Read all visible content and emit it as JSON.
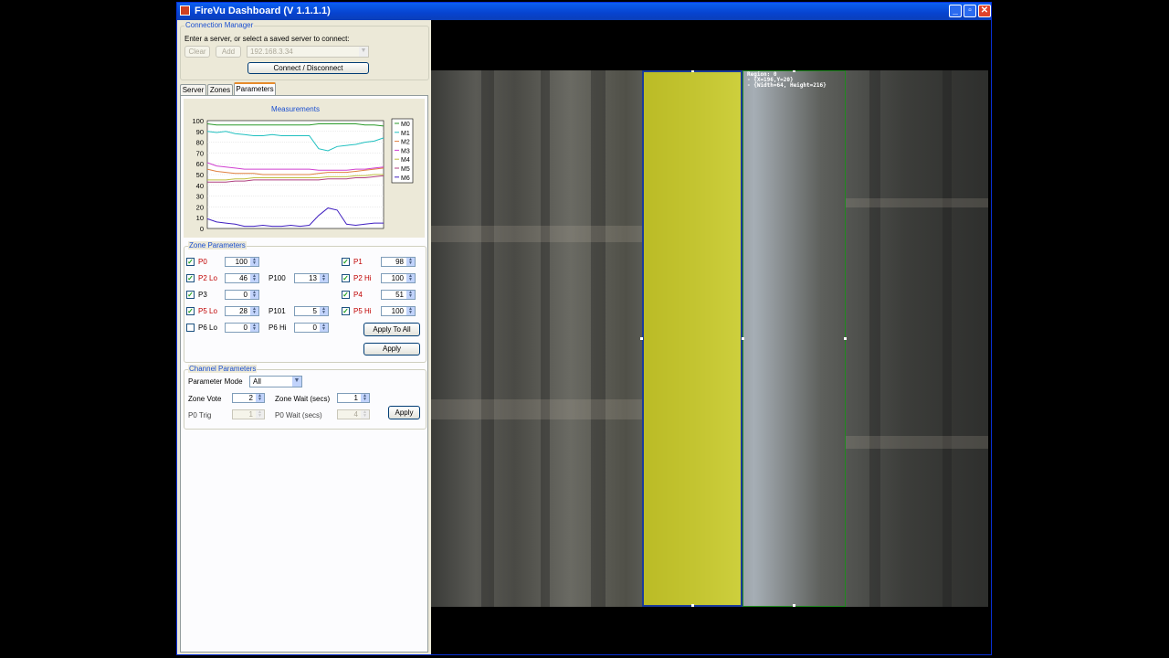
{
  "window": {
    "title": "FireVu Dashboard (V 1.1.1.1)"
  },
  "connection": {
    "legend": "Connection Manager",
    "prompt": "Enter a server, or select a saved server to connect:",
    "clear_label": "Clear",
    "add_label": "Add",
    "server_value": "192.168.3.34",
    "connect_label": "Connect / Disconnect"
  },
  "tabs": [
    "Server",
    "Zones",
    "Parameters"
  ],
  "chart_data": {
    "type": "line",
    "title": "Measurements",
    "xlabel": "",
    "ylabel": "",
    "ylim": [
      0,
      100
    ],
    "yticks": [
      "100",
      "90",
      "80",
      "70",
      "60",
      "50",
      "40",
      "30",
      "20",
      "10",
      "0"
    ],
    "legend_placement": "right",
    "series": [
      {
        "name": "M0",
        "color": "#2a9a2a",
        "values": [
          97,
          96,
          96,
          96,
          96,
          96,
          96,
          96,
          96,
          96,
          96,
          96,
          97,
          97,
          97,
          97,
          97,
          96,
          96,
          95
        ]
      },
      {
        "name": "M1",
        "color": "#20c0c0",
        "values": [
          90,
          89,
          90,
          88,
          87,
          86,
          86,
          87,
          86,
          86,
          86,
          86,
          74,
          72,
          76,
          77,
          78,
          80,
          81,
          84
        ]
      },
      {
        "name": "M2",
        "color": "#e08040",
        "values": [
          55,
          53,
          52,
          51,
          51,
          51,
          50,
          50,
          50,
          50,
          50,
          50,
          51,
          52,
          52,
          52,
          53,
          54,
          55,
          56
        ]
      },
      {
        "name": "M3",
        "color": "#d040d0",
        "values": [
          61,
          58,
          57,
          56,
          55,
          55,
          55,
          55,
          55,
          55,
          55,
          55,
          54,
          54,
          54,
          54,
          55,
          55,
          56,
          57
        ]
      },
      {
        "name": "M4",
        "color": "#c0c040",
        "values": [
          45,
          45,
          45,
          46,
          46,
          47,
          47,
          47,
          47,
          47,
          47,
          47,
          47,
          48,
          48,
          48,
          49,
          49,
          50,
          50
        ]
      },
      {
        "name": "M5",
        "color": "#b04080",
        "values": [
          43,
          43,
          43,
          44,
          44,
          45,
          45,
          45,
          45,
          45,
          45,
          45,
          45,
          46,
          46,
          46,
          47,
          47,
          48,
          49
        ]
      },
      {
        "name": "M6",
        "color": "#4020c0",
        "values": [
          9,
          6,
          5,
          4,
          2,
          2,
          3,
          2,
          2,
          3,
          2,
          3,
          12,
          19,
          17,
          4,
          3,
          4,
          5,
          5
        ]
      }
    ]
  },
  "zone_params": {
    "legend": "Zone Parameters",
    "rows": [
      {
        "name": "P0",
        "checked": true,
        "red": true,
        "value": "100"
      },
      {
        "name": "P1",
        "checked": true,
        "red": true,
        "value": "98"
      },
      {
        "name": "P2 Lo",
        "checked": true,
        "red": true,
        "value": "46"
      },
      {
        "name": "P100",
        "checked": false,
        "red": false,
        "value": "13"
      },
      {
        "name": "P2 Hi",
        "checked": true,
        "red": true,
        "value": "100"
      },
      {
        "name": "P3",
        "checked": true,
        "red": false,
        "value": "0"
      },
      {
        "name": "P4",
        "checked": true,
        "red": true,
        "value": "51"
      },
      {
        "name": "P5 Lo",
        "checked": true,
        "red": true,
        "value": "28"
      },
      {
        "name": "P101",
        "checked": false,
        "red": false,
        "value": "5"
      },
      {
        "name": "P5 Hi",
        "checked": true,
        "red": true,
        "value": "100"
      },
      {
        "name": "P6 Lo",
        "checked": false,
        "red": false,
        "value": "0"
      },
      {
        "name": "P6 Hi",
        "checked": false,
        "red": false,
        "value": "0"
      }
    ],
    "apply_all_label": "Apply To All",
    "apply_label": "Apply"
  },
  "channel_params": {
    "legend": "Channel Parameters",
    "mode_label": "Parameter Mode",
    "mode_value": "All",
    "zone_vote_label": "Zone Vote",
    "zone_vote_value": "2",
    "zone_wait_label": "Zone Wait (secs)",
    "zone_wait_value": "1",
    "p0_trig_label": "P0 Trig",
    "p0_trig_value": "1",
    "p0_wait_label": "P0 Wait (secs)",
    "p0_wait_value": "4",
    "apply_label": "Apply"
  },
  "video": {
    "region_info": "Region: 0\n- {X=196,Y=20}\n- {Width=64, Height=216}",
    "yellow_color": "#e1e114",
    "green_color": "#1f8a1f"
  }
}
